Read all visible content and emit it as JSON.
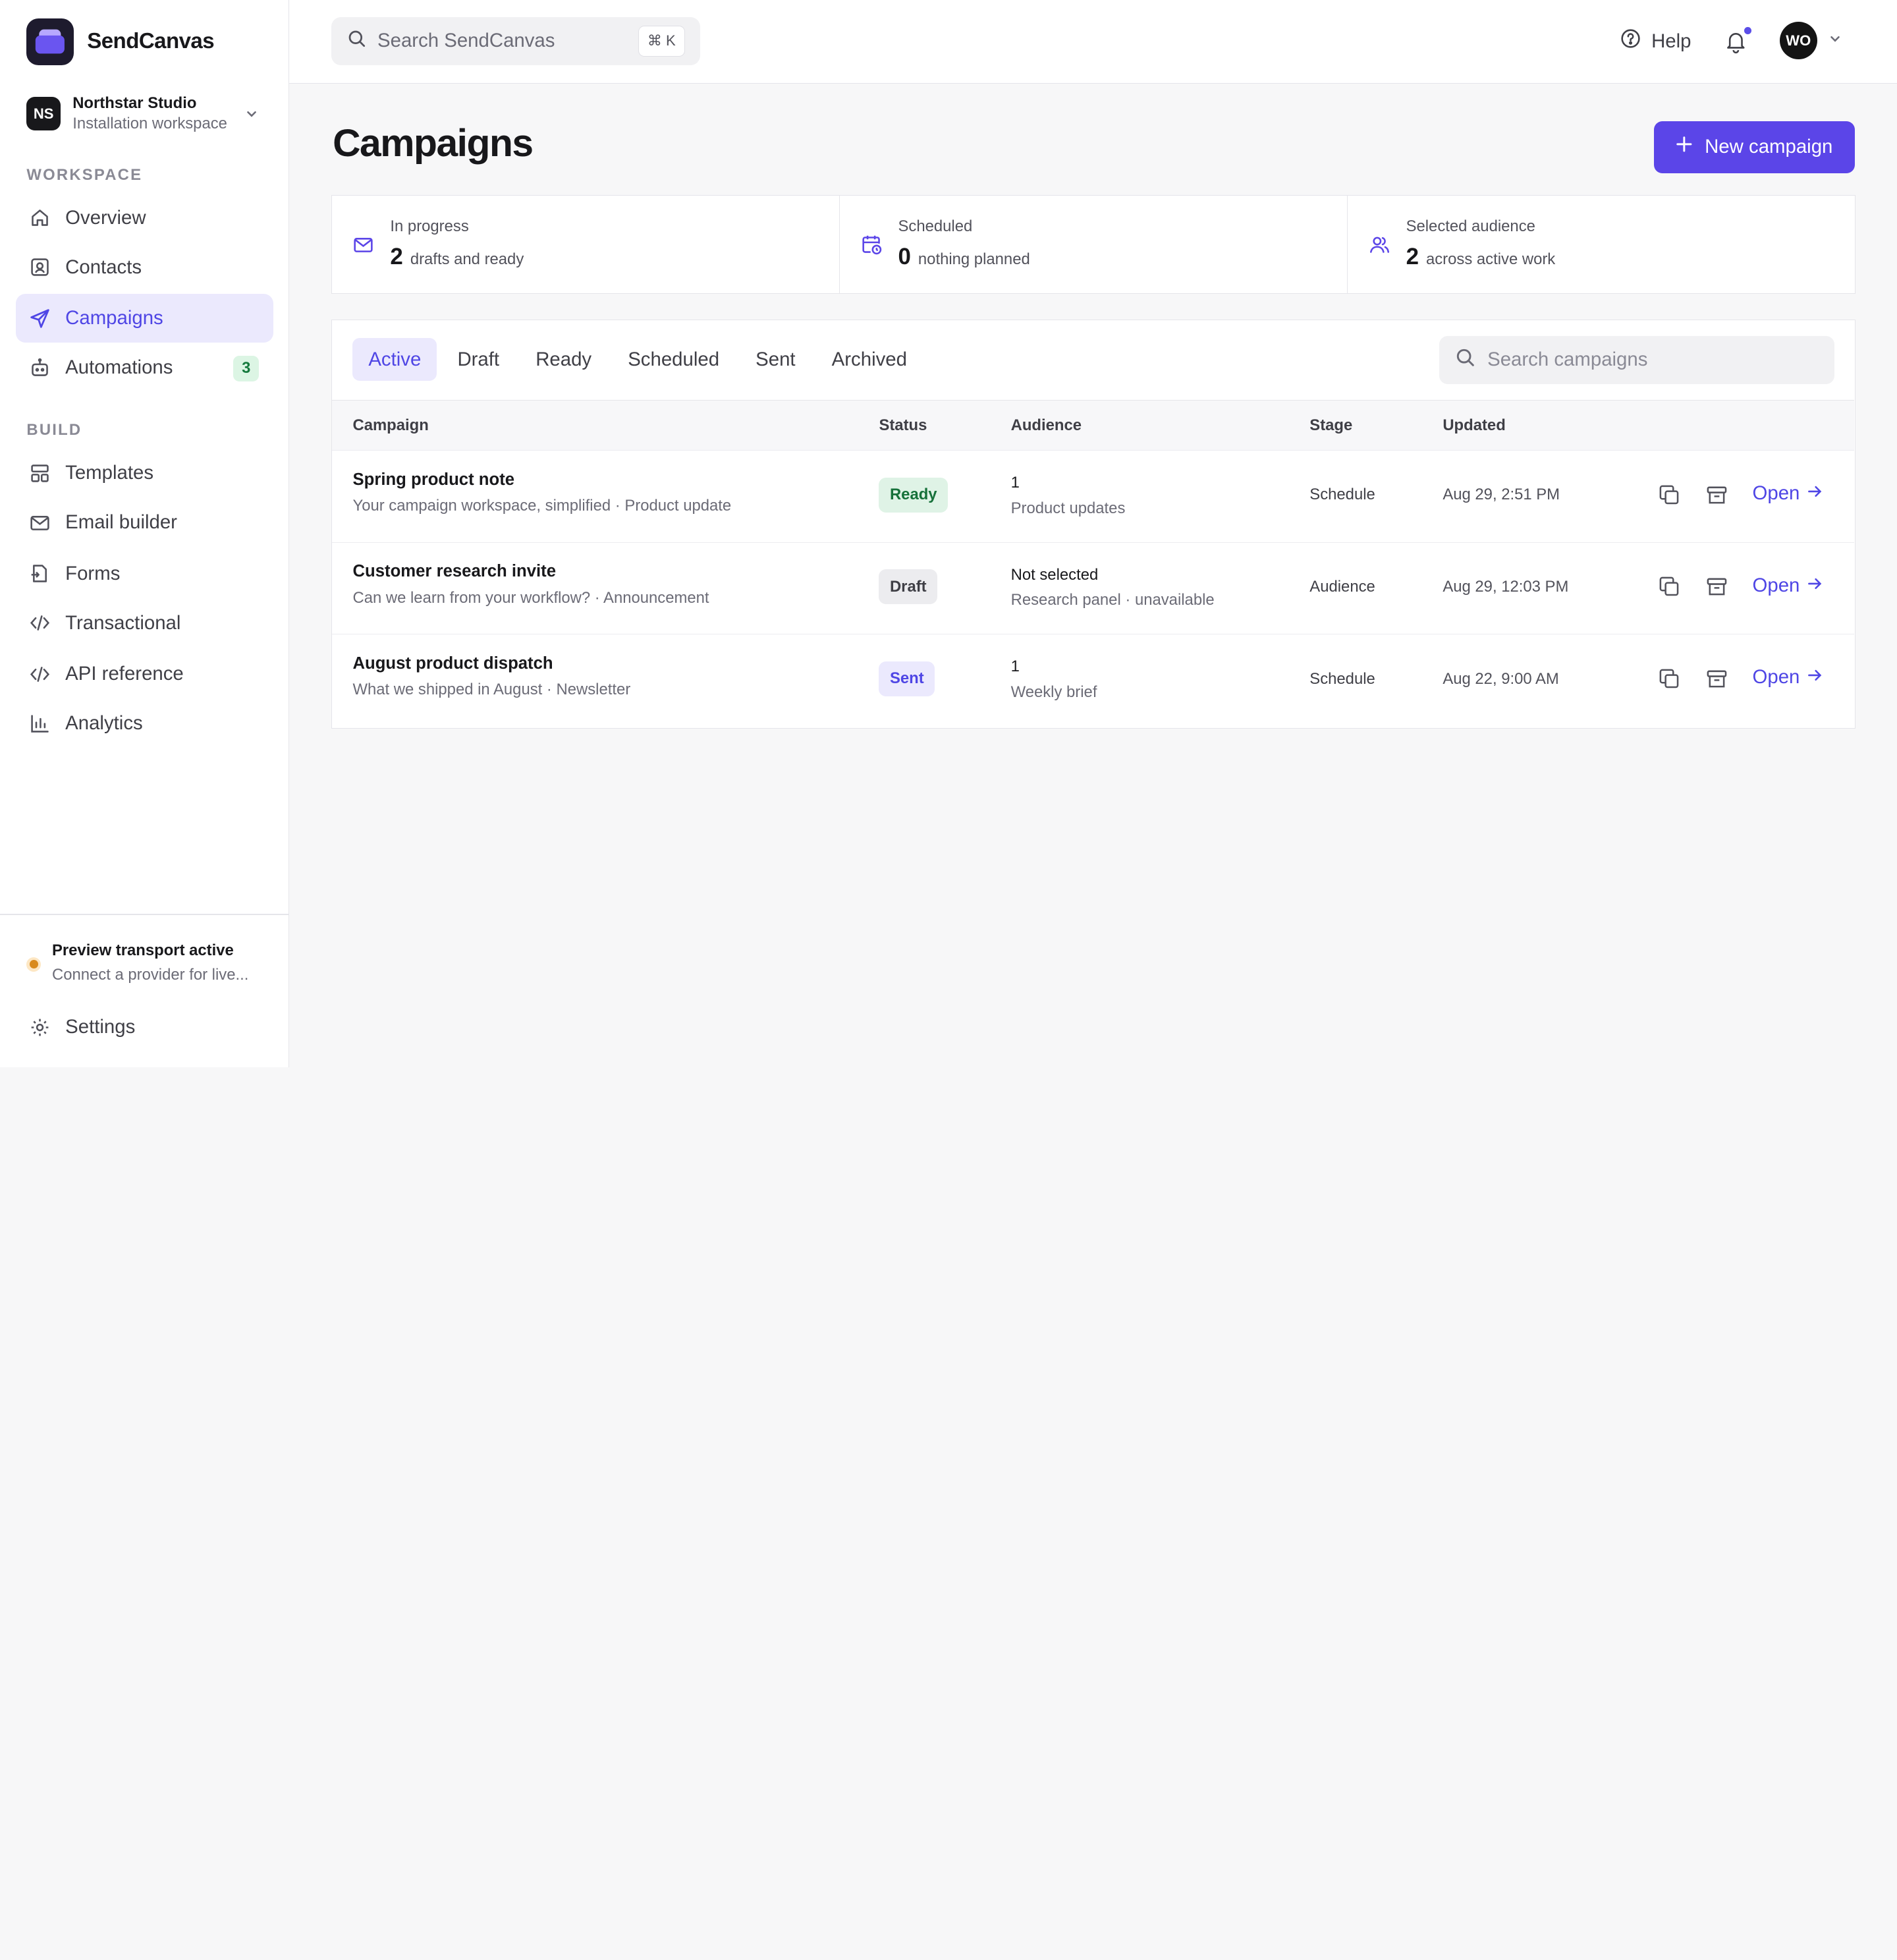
{
  "brand": {
    "name": "SendCanvas"
  },
  "workspace": {
    "initials": "NS",
    "name": "Northstar Studio",
    "subtitle": "Installation workspace"
  },
  "sidebar": {
    "sections": [
      {
        "label": "WORKSPACE"
      },
      {
        "label": "BUILD"
      }
    ],
    "items": [
      {
        "label": "Overview",
        "icon": "home-icon"
      },
      {
        "label": "Contacts",
        "icon": "contacts-icon"
      },
      {
        "label": "Campaigns",
        "icon": "send-icon",
        "active": true
      },
      {
        "label": "Automations",
        "icon": "bot-icon",
        "badge": "3"
      },
      {
        "label": "Templates",
        "icon": "templates-icon"
      },
      {
        "label": "Email builder",
        "icon": "mail-icon"
      },
      {
        "label": "Forms",
        "icon": "forms-icon"
      },
      {
        "label": "Transactional",
        "icon": "code-icon"
      },
      {
        "label": "API reference",
        "icon": "code-icon"
      },
      {
        "label": "Analytics",
        "icon": "chart-icon"
      }
    ],
    "transport": {
      "title": "Preview transport active",
      "subtitle": "Connect a provider for live..."
    },
    "settings_label": "Settings"
  },
  "topbar": {
    "search_placeholder": "Search SendCanvas",
    "shortcut": "⌘ K",
    "help_label": "Help",
    "user_initials": "WO"
  },
  "main": {
    "title": "Campaigns",
    "new_button_label": "New campaign",
    "stats": [
      {
        "label": "In progress",
        "value": "2",
        "desc": "drafts and ready",
        "icon": "mail-icon"
      },
      {
        "label": "Scheduled",
        "value": "0",
        "desc": "nothing planned",
        "icon": "calendar-clock-icon"
      },
      {
        "label": "Selected audience",
        "value": "2",
        "desc": "across active work",
        "icon": "users-icon"
      }
    ],
    "tabs": [
      "Active",
      "Draft",
      "Ready",
      "Scheduled",
      "Sent",
      "Archived"
    ],
    "active_tab": "Active",
    "campaign_search_placeholder": "Search campaigns",
    "table": {
      "headers": [
        "Campaign",
        "Status",
        "Audience",
        "Stage",
        "Updated"
      ],
      "rows": [
        {
          "name": "Spring product note",
          "sub": "Your campaign workspace, simplified · Product update",
          "status": "Ready",
          "audience": "1",
          "audience_sub": "Product updates",
          "stage": "Schedule",
          "updated": "Aug 29, 2:51 PM",
          "action": "Open"
        },
        {
          "name": "Customer research invite",
          "sub": "Can we learn from your workflow? · Announcement",
          "status": "Draft",
          "audience": "Not selected",
          "audience_sub": "Research panel · unavailable",
          "stage": "Audience",
          "updated": "Aug 29, 12:03 PM",
          "action": "Open"
        },
        {
          "name": "August product dispatch",
          "sub": "What we shipped in August · Newsletter",
          "status": "Sent",
          "audience": "1",
          "audience_sub": "Weekly brief",
          "stage": "Schedule",
          "updated": "Aug 22, 9:00 AM",
          "action": "Open"
        }
      ]
    }
  },
  "colors": {
    "accent": "#5b45e8",
    "accent_soft": "#ebe9fd",
    "ready": "#16713a",
    "warning_dot": "#d98a1c"
  }
}
